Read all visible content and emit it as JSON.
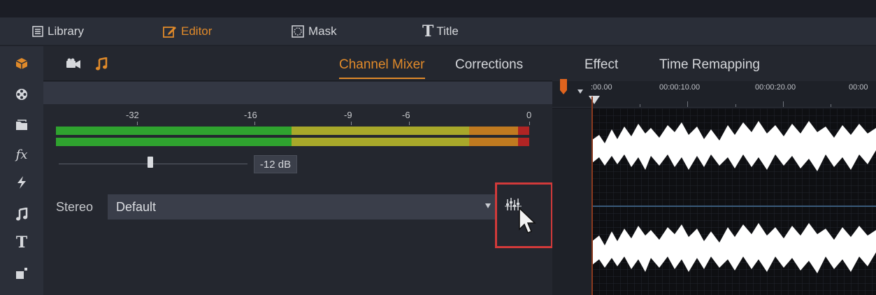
{
  "nav": {
    "tabs": [
      {
        "label": "Library",
        "icon": "library-icon"
      },
      {
        "label": "Editor",
        "icon": "editor-icon",
        "active": true
      },
      {
        "label": "Mask",
        "icon": "mask-icon"
      },
      {
        "label": "Title",
        "icon": "title-icon"
      }
    ]
  },
  "sidebar": {
    "icons": [
      "package-icon",
      "film-reel-icon",
      "folder-icon",
      "fx-icon",
      "lightning-icon",
      "music-note-icon",
      "title-t-icon",
      "montage-icon"
    ]
  },
  "panel": {
    "header_icons": [
      "video-camera-icon",
      "music-note-icon"
    ],
    "tabs": [
      {
        "label": "Channel Mixer",
        "active": true
      },
      {
        "label": "Corrections"
      },
      {
        "label": "Effect"
      },
      {
        "label": "Time Remapping"
      }
    ],
    "meter": {
      "scale_labels": [
        "-32",
        "-16",
        "-9",
        "-6",
        "0"
      ]
    },
    "volume": {
      "value_label": "-12 dB",
      "level": 0.5
    },
    "stereo": {
      "label": "Stereo",
      "selected": "Default"
    }
  },
  "timeline": {
    "timecodes": [
      ":00.00",
      "00:00:10.00",
      "00:00:20.00",
      "00:00"
    ]
  },
  "colors": {
    "accent": "#e08a2a",
    "highlight_box": "#d23a3a",
    "meter_green": "#2fa32f",
    "meter_yellow": "#a8a82a",
    "meter_orange": "#c07a20",
    "meter_red": "#b02424"
  }
}
